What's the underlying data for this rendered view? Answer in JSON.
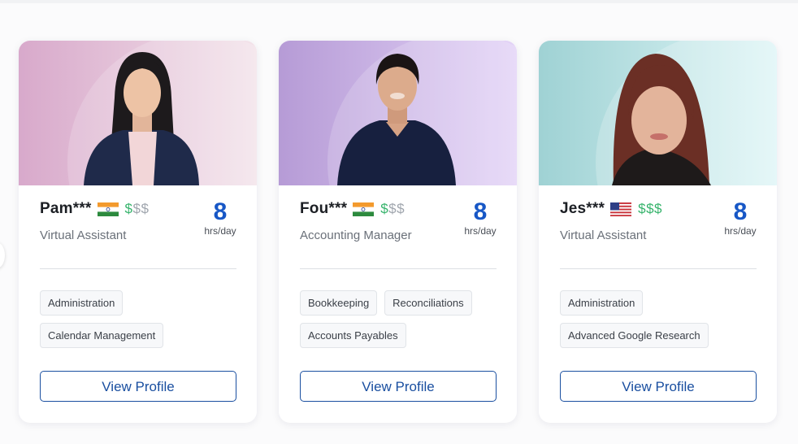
{
  "cards": [
    {
      "name": "Pam***",
      "flag": "india-flag-icon",
      "price": "$$$",
      "price_filled": 1,
      "role": "Virtual Assistant",
      "hours_value": "8",
      "hours_unit": "hrs/day",
      "skills": [
        "Administration",
        "Calendar Management"
      ],
      "button_label": "View Profile",
      "photo_bg": [
        "#d8a9cb",
        "#f3e3ea"
      ]
    },
    {
      "name": "Fou***",
      "flag": "india-flag-icon",
      "price": "$$$",
      "price_filled": 1,
      "role": "Accounting Manager",
      "hours_value": "8",
      "hours_unit": "hrs/day",
      "skills": [
        "Bookkeeping",
        "Reconciliations",
        "Accounts Payables"
      ],
      "button_label": "View Profile",
      "photo_bg": [
        "#b69bd6",
        "#e3d3f7"
      ]
    },
    {
      "name": "Jes***",
      "flag": "usa-flag-icon",
      "price": "$$$",
      "price_filled": 3,
      "role": "Virtual Assistant",
      "hours_value": "8",
      "hours_unit": "hrs/day",
      "skills": [
        "Administration",
        "Advanced Google Research"
      ],
      "button_label": "View Profile",
      "photo_bg": [
        "#9fd2d4",
        "#def5f6"
      ]
    }
  ],
  "colors": {
    "price_green": "#35b36b",
    "hours_blue": "#1757c6",
    "button_blue": "#1a4fa0"
  }
}
